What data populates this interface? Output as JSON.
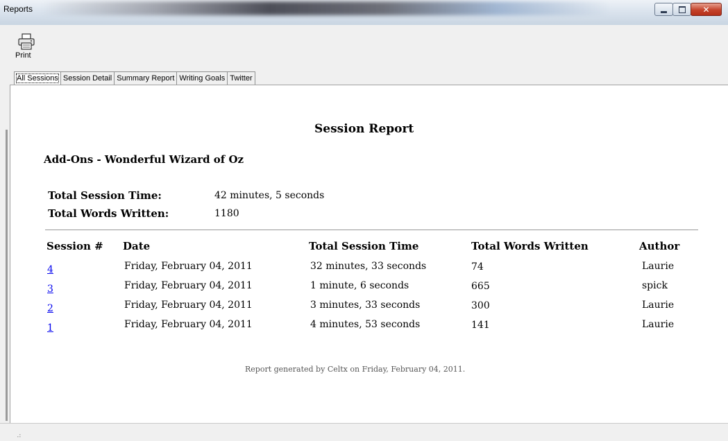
{
  "window": {
    "title": "Reports"
  },
  "toolbar": {
    "print_label": "Print"
  },
  "tabs": [
    {
      "label": "All Sessions",
      "active": true
    },
    {
      "label": "Session Detail"
    },
    {
      "label": "Summary Report"
    },
    {
      "label": "Writing Goals"
    },
    {
      "label": "Twitter"
    }
  ],
  "report": {
    "title": "Session Report",
    "project": "Add-Ons - Wonderful Wizard of Oz",
    "totals": {
      "time_label": "Total Session Time:",
      "time_value": "42 minutes, 5 seconds",
      "words_label": "Total Words Written:",
      "words_value": "1180"
    },
    "columns": [
      "Session #",
      "Date",
      "Total Session Time",
      "Total Words Written",
      "Author"
    ],
    "rows": [
      {
        "session": "4",
        "date": "Friday, February 04, 2011",
        "time": "32 minutes, 33 seconds",
        "words": "74",
        "author": "Laurie"
      },
      {
        "session": "3",
        "date": "Friday, February 04, 2011",
        "time": "1 minute, 6 seconds",
        "words": "665",
        "author": "spick"
      },
      {
        "session": "2",
        "date": "Friday, February 04, 2011",
        "time": "3 minutes, 33 seconds",
        "words": "300",
        "author": "Laurie"
      },
      {
        "session": "1",
        "date": "Friday, February 04, 2011",
        "time": "4 minutes, 53 seconds",
        "words": "141",
        "author": "Laurie"
      }
    ],
    "footer": "Report generated by Celtx on Friday, February 04, 2011."
  },
  "icons": {
    "print": "printer-icon",
    "minimize": "minimize-icon",
    "maximize": "maximize-icon",
    "close": "close-icon",
    "grip": "resize-grip-icon"
  },
  "colors": {
    "link": "#0000ee",
    "close_button": "#c4432b"
  }
}
